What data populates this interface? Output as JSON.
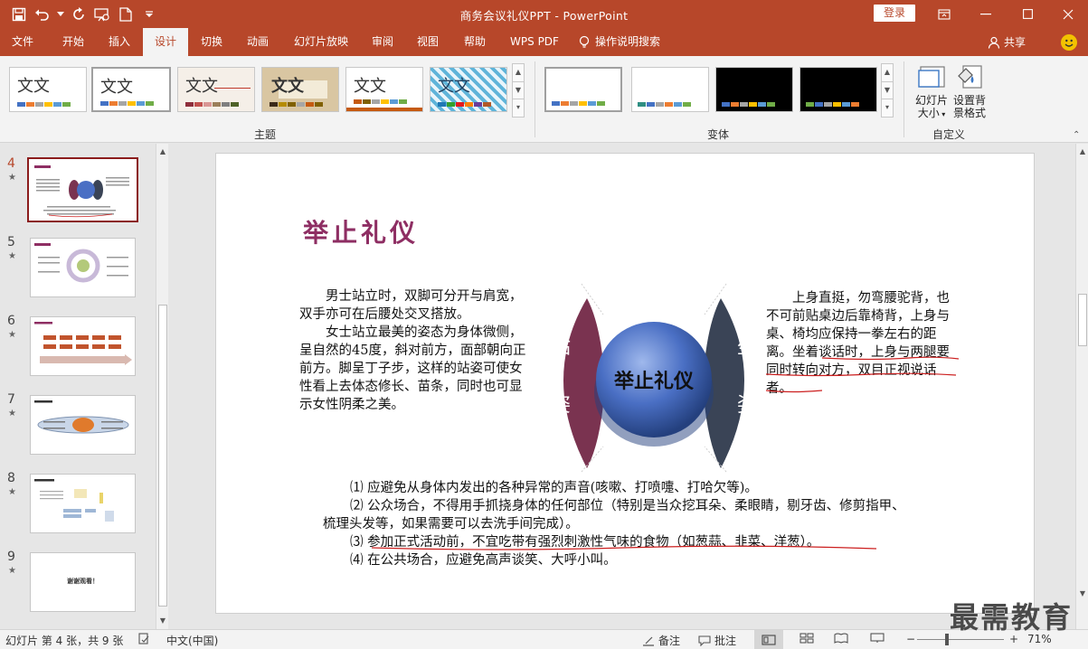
{
  "app": {
    "title": "商务会议礼仪PPT  -  PowerPoint",
    "login": "登录"
  },
  "tabs": [
    {
      "label": "文件"
    },
    {
      "label": "开始"
    },
    {
      "label": "插入"
    },
    {
      "label": "设计"
    },
    {
      "label": "切换"
    },
    {
      "label": "动画"
    },
    {
      "label": "幻灯片放映"
    },
    {
      "label": "审阅"
    },
    {
      "label": "视图"
    },
    {
      "label": "帮助"
    },
    {
      "label": "WPS PDF"
    }
  ],
  "tellme": "操作说明搜索",
  "share": "共享",
  "ribbon": {
    "themes_label": "主题",
    "variants_label": "变体",
    "customize_label": "自定义",
    "theme_text": "文文",
    "slide_size": "幻灯片大小",
    "slide_size_line1": "幻灯片",
    "slide_size_line2": "大小",
    "format_bg_line1": "设置背",
    "format_bg_line2": "景格式"
  },
  "slides_panel": [
    {
      "num": "4",
      "current": true
    },
    {
      "num": "5"
    },
    {
      "num": "6"
    },
    {
      "num": "7"
    },
    {
      "num": "8"
    },
    {
      "num": "9",
      "text": "谢谢观看！"
    }
  ],
  "slide": {
    "title": "举止礼仪",
    "center": "举止礼仪",
    "left_chars": [
      "站",
      "姿"
    ],
    "right_chars": [
      "坐",
      "姿"
    ],
    "left_para": [
      "男士站立时，双脚可分开与肩宽，双手亦可在后腰处交叉搭放。",
      "女士站立最美的姿态为身体微侧，呈自然的45度，斜对前方，面部朝向正前方。脚呈丁子步，这样的站姿可使女性看上去体态修长、苗条，同时也可显示女性阴柔之美。"
    ],
    "right_para": "上身直挺，勿弯腰驼背，也不可前贴桌边后靠椅背，上身与桌、椅均应保持一拳左右的距离。坐着谈话时，上身与两腿要同时转向对方，双目正视说话者。",
    "bullets": [
      "⑴ 应避免从身体内发出的各种异常的声音(咳嗽、打喷嚏、打哈欠等)。",
      "⑵ 公众场合，不得用手抓挠身体的任何部位（特别是当众挖耳朵、柔眼睛，剔牙齿、修剪指甲、梳理头发等，如果需要可以去洗手间完成）。",
      "⑶ 参加正式活动前，不宜吃带有强烈刺激性气味的食物（如葱蒜、韭菜、洋葱）。",
      "⑷ 在公共场合，应避免高声谈笑、大呼小叫。"
    ]
  },
  "status": {
    "slide_info": "幻灯片 第 4 张，共 9 张",
    "language": "中文(中国)",
    "notes": "备注",
    "comments": "批注",
    "zoom": "71%"
  },
  "watermark": "最需教育",
  "colors": {
    "accent": "#b7472a",
    "title_purple": "#8e2e63",
    "ellipse_left": "#7a3350",
    "ellipse_right": "#3a4456",
    "sphere": "#4a6fc4",
    "underline": "#cc1f1f"
  }
}
